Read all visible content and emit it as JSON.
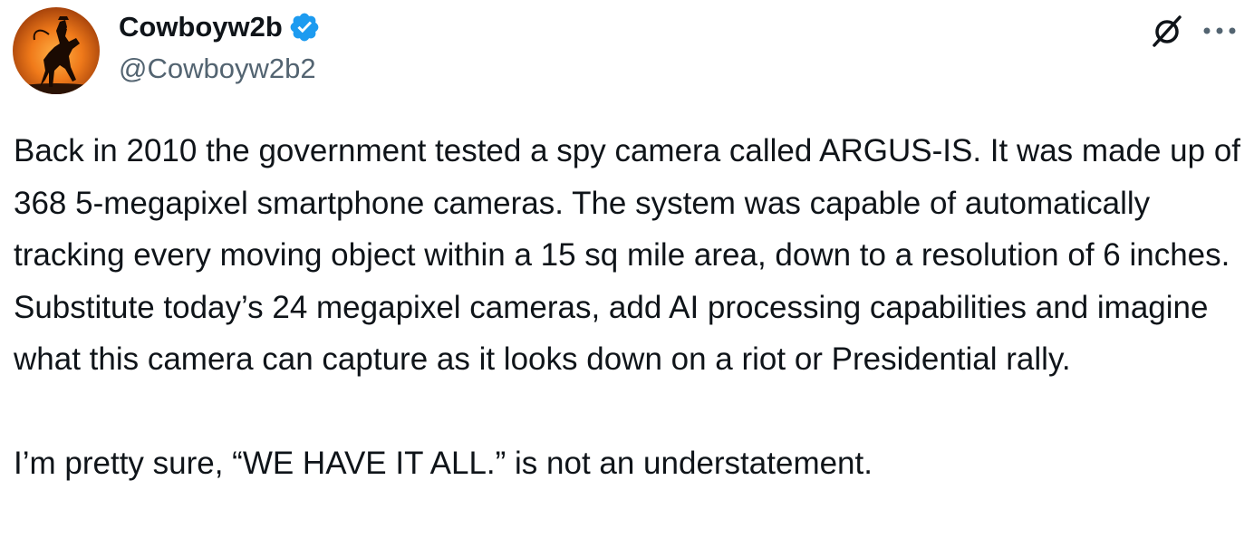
{
  "tweet": {
    "author": {
      "display_name": "Cowboyw2b",
      "handle": "@Cowboyw2b2",
      "verified": true,
      "avatar_icon": "cowboy-on-rearing-horse-silhouette-at-sunset",
      "verified_color": "#1d9bf0"
    },
    "actions": {
      "grok_icon": "grok-slash-icon",
      "more_icon": "more-dots-icon"
    },
    "paragraphs": [
      "Back in 2010 the government tested a spy camera called ARGUS-IS. It was made up of 368 5-megapixel smartphone cameras. The system was capable of automatically tracking every moving object within a 15 sq mile area, down to a resolution of 6 inches. Substitute today’s 24 megapixel cameras, add AI processing capabilities and imagine what this camera can capture as it looks down on a riot or Presidential rally.",
      "I’m pretty sure, “WE HAVE IT ALL.” is not an understatement."
    ]
  }
}
